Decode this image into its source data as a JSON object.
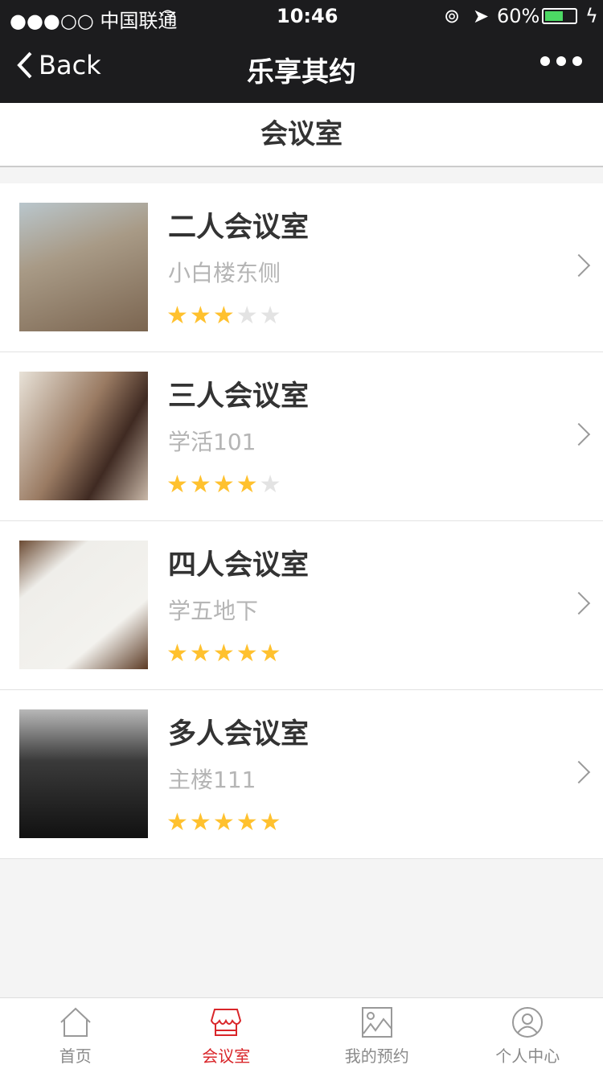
{
  "status": {
    "carrier": "●●●○○ 中国联通",
    "time": "10:46",
    "battery": "60%"
  },
  "nav": {
    "back": "Back",
    "title": "乐享其约"
  },
  "header": {
    "title": "会议室"
  },
  "rooms": [
    {
      "name": "二人会议室",
      "location": "小白楼东侧",
      "rating": 3
    },
    {
      "name": "三人会议室",
      "location": "学活101",
      "rating": 4
    },
    {
      "name": "四人会议室",
      "location": "学五地下",
      "rating": 5
    },
    {
      "name": "多人会议室",
      "location": "主楼111",
      "rating": 5
    }
  ],
  "tabs": [
    {
      "label": "首页"
    },
    {
      "label": "会议室"
    },
    {
      "label": "我的预约"
    },
    {
      "label": "个人中心"
    }
  ],
  "colors": {
    "accent": "#d9262a",
    "star": "#ffc12e"
  }
}
